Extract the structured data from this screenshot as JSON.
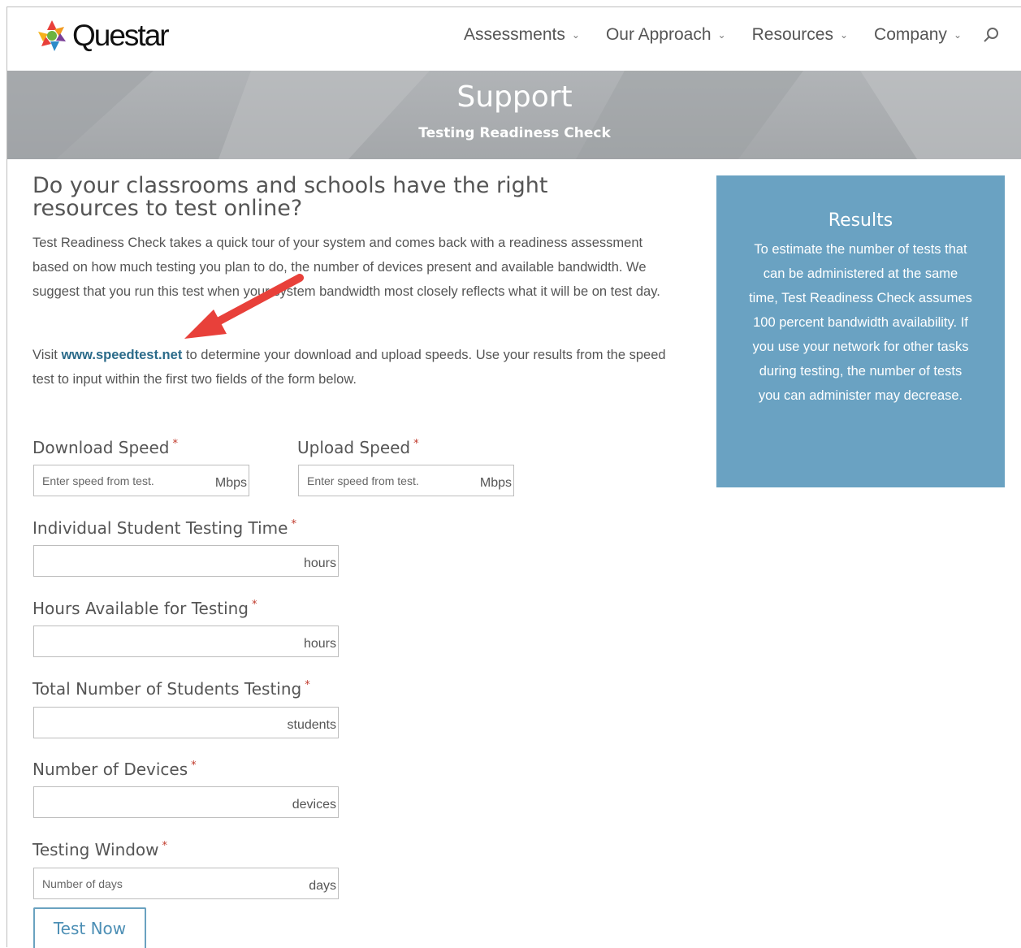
{
  "header": {
    "logo_text": "Questar",
    "nav": [
      {
        "label": "Assessments"
      },
      {
        "label": "Our Approach"
      },
      {
        "label": "Resources"
      },
      {
        "label": "Company"
      }
    ],
    "icons": {
      "search": "search-icon",
      "chevron": "chevron-down-icon"
    }
  },
  "banner": {
    "title": "Support",
    "subtitle": "Testing Readiness Check"
  },
  "main": {
    "heading": "Do your classrooms and schools have the right resources to test online?",
    "intro": "Test Readiness Check takes a quick tour of your system and comes back with a readiness assessment based on how much testing you plan to do, the number of devices present and available bandwidth. We suggest that you run this test when your system bandwidth most closely reflects what it will be on test day.",
    "visit_prefix": "Visit ",
    "visit_link": "www.speedtest.net",
    "visit_suffix": " to determine your download and upload speeds. Use your results from the speed test to input within the first two fields of the form below."
  },
  "form": {
    "required_mark": "*",
    "download": {
      "label": "Download Speed",
      "placeholder": "Enter speed from test.",
      "unit": "Mbps",
      "value": ""
    },
    "upload": {
      "label": "Upload Speed",
      "placeholder": "Enter speed from test.",
      "unit": "Mbps",
      "value": ""
    },
    "student_time": {
      "label": "Individual Student Testing Time",
      "placeholder": "",
      "unit": "hours",
      "value": ""
    },
    "hours_available": {
      "label": "Hours Available for Testing",
      "placeholder": "",
      "unit": "hours",
      "value": ""
    },
    "total_students": {
      "label": "Total Number of Students Testing",
      "placeholder": "",
      "unit": "students",
      "value": ""
    },
    "devices": {
      "label": "Number of Devices",
      "placeholder": "",
      "unit": "devices",
      "value": ""
    },
    "window": {
      "label": "Testing Window",
      "placeholder": "Number of days",
      "unit": "days",
      "value": ""
    },
    "submit_label": "Test Now"
  },
  "results": {
    "title": "Results",
    "text": "To estimate the number of tests that can be administered at the same time, Test Readiness Check assumes 100 percent bandwidth availability. If you use your network for other tasks during testing, the number of tests you can administer may decrease."
  },
  "colors": {
    "results_bg": "#6aa2c2",
    "link": "#2b6b8a",
    "annotation_arrow": "#e8403a",
    "required": "#c0392b"
  }
}
